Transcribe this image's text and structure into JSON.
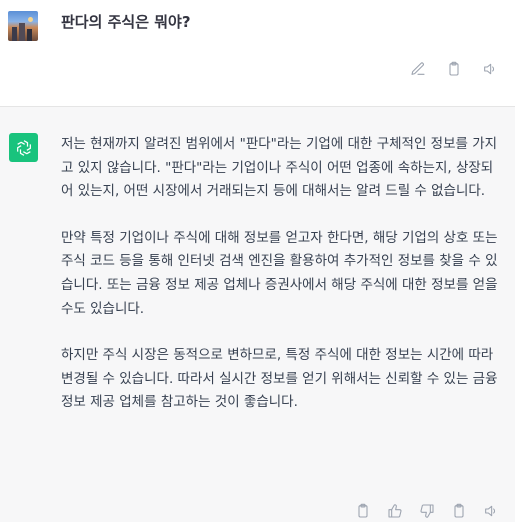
{
  "user": {
    "message": "판다의 주식은 뭐야?"
  },
  "assistant": {
    "paragraphs": [
      "저는 현재까지 알려진 범위에서 \"판다\"라는 기업에 대한 구체적인 정보를 가지고 있지 않습니다. \"판다\"라는 기업이나 주식이 어떤 업종에 속하는지, 상장되어 있는지, 어떤 시장에서 거래되는지 등에 대해서는 알려 드릴 수 없습니다.",
      "만약 특정 기업이나 주식에 대해 정보를 얻고자 한다면, 해당 기업의 상호 또는 주식 코드 등을 통해 인터넷 검색 엔진을 활용하여 추가적인 정보를 찾을 수 있습니다. 또는 금융 정보 제공 업체나 증권사에서 해당 주식에 대한 정보를 얻을 수도 있습니다.",
      "하지만 주식 시장은 동적으로 변하므로, 특정 주식에 대한 정보는 시간에 따라 변경될 수 있습니다. 따라서 실시간 정보를 얻기 위해서는 신뢰할 수 있는 금융 정보 제공 업체를 참고하는 것이 좋습니다."
    ]
  },
  "colors": {
    "accent": "#19c37d",
    "assistant_bg": "#f7f7f8",
    "icon": "#9ca3af"
  },
  "icons": {
    "user_actions": [
      "edit-icon",
      "clipboard-icon",
      "speaker-icon"
    ],
    "assistant_actions": [
      "clipboard-icon",
      "thumbs-up-icon",
      "thumbs-down-icon",
      "clipboard-icon",
      "speaker-icon"
    ]
  }
}
